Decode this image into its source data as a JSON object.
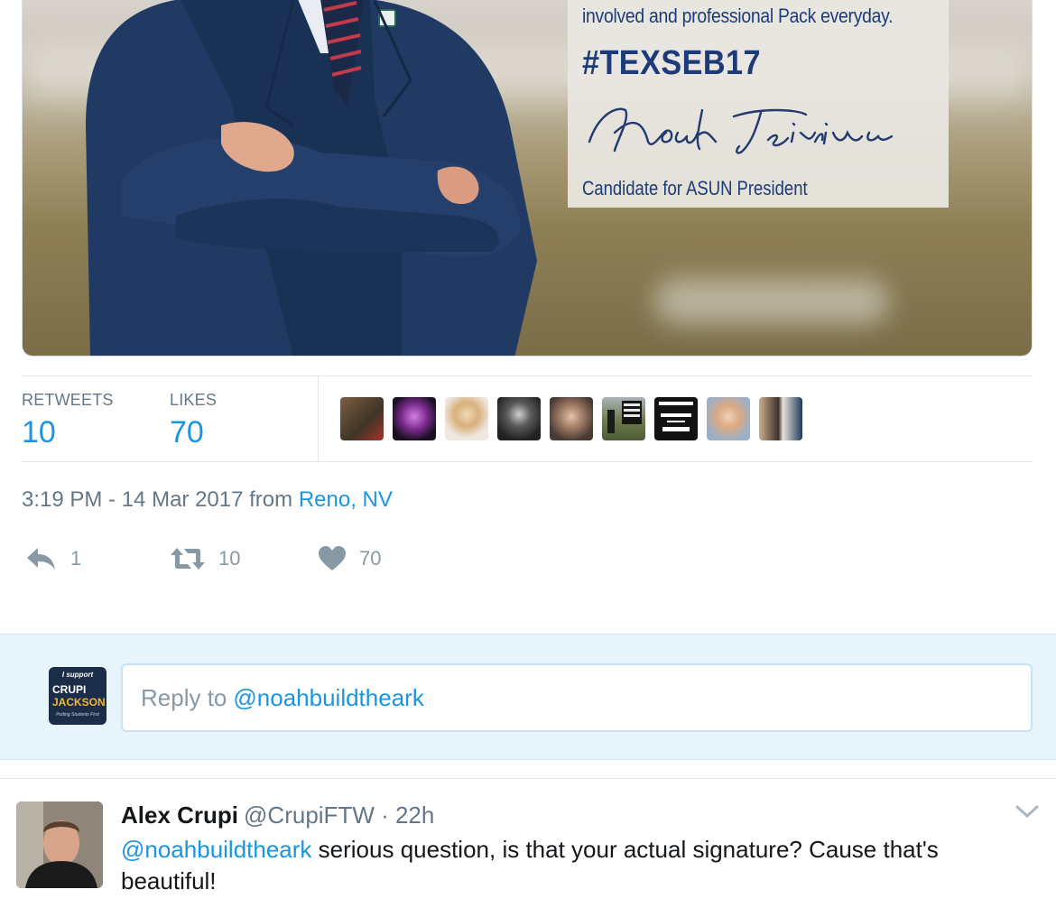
{
  "media": {
    "promo_line": "involved and professional Pack everyday.",
    "hashtag": "#TEXSEB17",
    "signature": "Noah Teixeira",
    "role": "Candidate for ASUN President"
  },
  "stats": {
    "retweets_label": "RETWEETS",
    "retweets_count": "10",
    "likes_label": "LIKES",
    "likes_count": "70",
    "liker_avatars": [
      {
        "name": "liker-avatar-1",
        "color": "#5a4636"
      },
      {
        "name": "liker-avatar-2",
        "color": "#3b1f4a",
        "accent": "#c46bd8"
      },
      {
        "name": "liker-avatar-3",
        "color": "#e8dcd0",
        "accent": "#d6b07a"
      },
      {
        "name": "liker-avatar-4",
        "color": "#3a3a3a"
      },
      {
        "name": "liker-avatar-5",
        "color": "#8c7564"
      },
      {
        "name": "liker-avatar-6",
        "color": "#6a7a48",
        "text": "TEIXEIRA ATIENZA"
      },
      {
        "name": "liker-avatar-7",
        "color": "#111111",
        "text": "I SUPPORT TEIXEIRA ATIENZA"
      },
      {
        "name": "liker-avatar-8",
        "color": "#d9b89a"
      },
      {
        "name": "liker-avatar-9",
        "color": "#b8a07c"
      }
    ]
  },
  "timestamp": {
    "time": "3:19 PM - 14 Mar 2017 from",
    "location": "Reno, NV"
  },
  "actions": {
    "reply_count": "1",
    "retweet_count": "10",
    "like_count": "70"
  },
  "composer": {
    "avatar_line1": "I support",
    "avatar_line2": "CRUPI",
    "avatar_line3": "JACKSON",
    "avatar_line4": "Putting Students First",
    "placeholder_prefix": "Reply to",
    "placeholder_mention": "@noahbuildtheark"
  },
  "reply_tweet": {
    "name": "Alex Crupi",
    "handle": "@CrupiFTW · 22h",
    "mention": "@noahbuildtheark",
    "text": " serious question, is that your actual signature? Cause that's beautiful!"
  },
  "colors": {
    "link_blue": "#1b95e0",
    "muted_gray": "#657786",
    "composer_bg": "#e8f4fb",
    "promo_navy": "#1d3b78"
  }
}
